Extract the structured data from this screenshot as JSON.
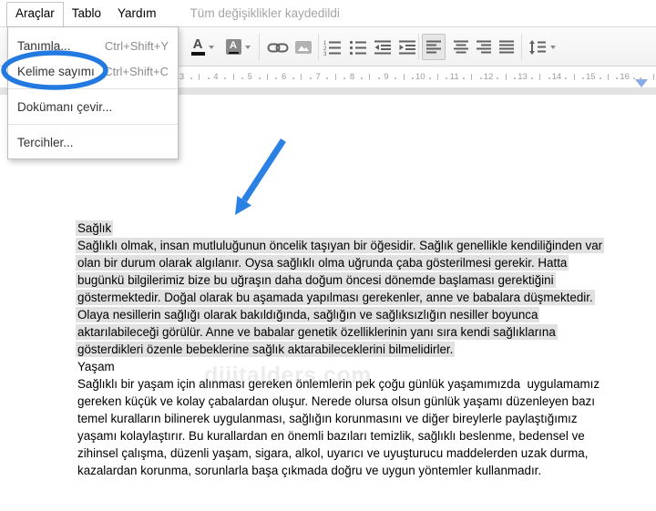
{
  "menubar": {
    "items": [
      {
        "label": "Araçlar",
        "active": true
      },
      {
        "label": "Tablo",
        "active": false
      },
      {
        "label": "Yardım",
        "active": false
      }
    ],
    "status": "Tüm değişiklikler kaydedildi"
  },
  "tools_menu": {
    "items": [
      {
        "label": "Tanımla...",
        "shortcut": "Ctrl+Shift+Y",
        "circled": false
      },
      {
        "label": "Kelime sayımı",
        "shortcut": "Ctrl+Shift+C",
        "circled": true
      },
      {
        "separator": true
      },
      {
        "label": "Dokümanı çevir...",
        "shortcut": "",
        "circled": false
      },
      {
        "separator": true
      },
      {
        "label": "Tercihler...",
        "shortcut": "",
        "circled": false
      }
    ]
  },
  "toolbar": {
    "buttons": [
      "text-color",
      "highlight-color",
      "insert-link",
      "insert-image",
      "numbered-list",
      "bulleted-list",
      "decrease-indent",
      "increase-indent",
      "align-left",
      "align-center",
      "align-right",
      "justify",
      "line-spacing"
    ],
    "pressed_button": "align-left",
    "icons": {
      "text_color_glyph": "A",
      "highlight_glyph": "A"
    }
  },
  "ruler": {
    "numbers": [
      "3",
      "4",
      "5",
      "6",
      "7",
      "8",
      "9",
      "10",
      "11",
      "12",
      "13",
      "14",
      "15",
      "16"
    ]
  },
  "annotations": {
    "circle_color": "#227ae0",
    "ellipse_color": "#227ae0",
    "arrow_color": "#2b80e4"
  },
  "watermark": "dijitalders.com",
  "document": {
    "selection_color": "#e1e1e1",
    "lines": [
      {
        "text": "Sağlık",
        "selected": true
      },
      {
        "text": "Sağlıklı olmak, insan mutluluğunun öncelik taşıyan bir öğesidir. Sağlık genellikle kendiliğinden var",
        "selected": true
      },
      {
        "text": "olan bir durum olarak algılanır. Oysa sağlıklı olma uğrunda çaba gösterilmesi gerekir. Hatta",
        "selected": true
      },
      {
        "text": "bugünkü bilgilerimiz bize bu uğraşın daha doğum öncesi dönemde başlaması gerektiğini",
        "selected": true
      },
      {
        "text": "göstermektedir. Doğal olarak bu aşamada yapılması gerekenler, anne ve babalara düşmektedir.",
        "selected": true
      },
      {
        "text": "Olaya nesillerin sağlığı olarak bakıldığında, sağlığın ve sağlıksızlığın nesiller boyunca",
        "selected": true
      },
      {
        "text": "aktarılabileceği görülür. Anne ve babalar genetik özelliklerinin yanı sıra kendi sağlıklarına",
        "selected": true
      },
      {
        "text": "gösterdikleri özenle bebeklerine sağlık aktarabileceklerini bilmelidirler.",
        "selected": true
      },
      {
        "text": "Yaşam",
        "selected": false
      },
      {
        "text": "Sağlıklı bir yaşam için alınması gereken önlemlerin pek çoğu günlük yaşamımızda  uygulamamız",
        "selected": false
      },
      {
        "text": "gereken küçük ve kolay çabalardan oluşur. Nerede olursa olsun günlük yaşamı düzenleyen bazı",
        "selected": false
      },
      {
        "text": "temel kuralların bilinerek uygulanması, sağlığın korunmasını ve diğer bireylerle paylaştığımız",
        "selected": false
      },
      {
        "text": "yaşamı kolaylaştırır. Bu kurallardan en önemli bazıları temizlik, sağlıklı beslenme, bedensel ve",
        "selected": false
      },
      {
        "text": "zihinsel çalışma, düzenli yaşam, sigara, alkol, uyarıcı ve uyuşturucu maddelerden uzak durma,",
        "selected": false
      },
      {
        "text": "kazalardan korunma, sorunlarla başa çıkmada doğru ve uygun yöntemler kullanmadır.",
        "selected": false
      }
    ]
  }
}
